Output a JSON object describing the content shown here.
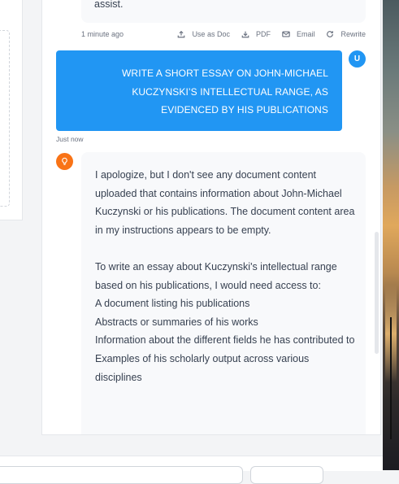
{
  "previous_message": {
    "tail_text": "assist.",
    "time": "1 minute ago",
    "actions": [
      {
        "label": "Use as Doc",
        "icon": "upload-icon"
      },
      {
        "label": "PDF",
        "icon": "download-icon"
      },
      {
        "label": "Email",
        "icon": "mail-icon"
      },
      {
        "label": "Rewrite",
        "icon": "refresh-icon"
      }
    ]
  },
  "user_message": {
    "avatar_letter": "U",
    "lines": [
      "WRITE A SHORT ESSAY ON JOHN-MICHAEL",
      "KUCZYNSKI’S INTELLECTUAL RANGE, AS",
      "EVIDENCED BY HIS PUBLICATIONS"
    ],
    "time": "Just now"
  },
  "assistant_message": {
    "avatar_icon": "lightbulb-icon",
    "paragraph1": "I apologize, but I don't see any document content uploaded that contains information about John-Michael Kuczynski or his publications. The document content area in my instructions appears to be empty.",
    "paragraph2": "To write an essay about Kuczynski's intellectual range based on his publications, I would need access to:",
    "list": [
      "A document listing his publications",
      "Abstracts or summaries of his works",
      "Information about the different fields he has contributed to",
      "Examples of his scholarly output across various disciplines"
    ]
  },
  "colors": {
    "user_bubble": "#2196f3",
    "assistant_avatar": "#f97316",
    "assistant_bubble": "#f8f9fb"
  }
}
